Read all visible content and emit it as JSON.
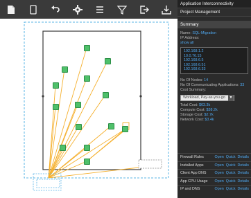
{
  "toolbar": {
    "icons": [
      "document-icon",
      "page-icon",
      "undo-icon",
      "gear-icon",
      "list-icon",
      "filter-icon",
      "export-icon",
      "download-icon"
    ]
  },
  "panel": {
    "title": "Application Interconnectivity",
    "subtitle": "Project Management",
    "summary_title": "Summary",
    "name_label": "Name:",
    "name_value": "SQL-Migration",
    "ip_label": "IP Address:",
    "show_all": "show all",
    "ips": [
      "192.168.1.2",
      "10.0.76.15",
      "192.168.6.5",
      "192.168.6.51",
      "192.168.6.33"
    ],
    "nodes_label": "No Of Nodes:",
    "nodes_value": "14",
    "comm_label": "No Of Communicating Applications:",
    "comm_value": "33",
    "cost_label": "Cost Summary:",
    "workload_select": "Workload, Pay-as-you-go",
    "total_label": "Total Cost:",
    "total_value": "$63.3k",
    "compute_label": "Compute Cost:",
    "compute_value": "$38.2k",
    "storage_label": "Storage Cost:",
    "storage_value": "$2.7k",
    "network_label": "Network Cost:",
    "network_value": "$3.4k",
    "rows": [
      {
        "label": "Firewall Rules",
        "open": "Open",
        "quick": "Quick",
        "details": "Details"
      },
      {
        "label": "Installed Apps",
        "open": "Open",
        "quick": "Quick",
        "details": "Details"
      },
      {
        "label": "Client App DNS",
        "open": "Open",
        "quick": "Quick",
        "details": "Details"
      },
      {
        "label": "App CPU Usage",
        "open": "Open",
        "quick": "Quick",
        "details": "Details"
      },
      {
        "label": "IP and DNS",
        "open": "Open",
        "quick": "Quick",
        "details": "Details"
      }
    ]
  },
  "colors": {
    "node": "#4fc06a",
    "edge": "#f5b02e",
    "link": "#4fa8f0",
    "panel": "#2b2b2b",
    "selection": "#5ab4e6"
  }
}
